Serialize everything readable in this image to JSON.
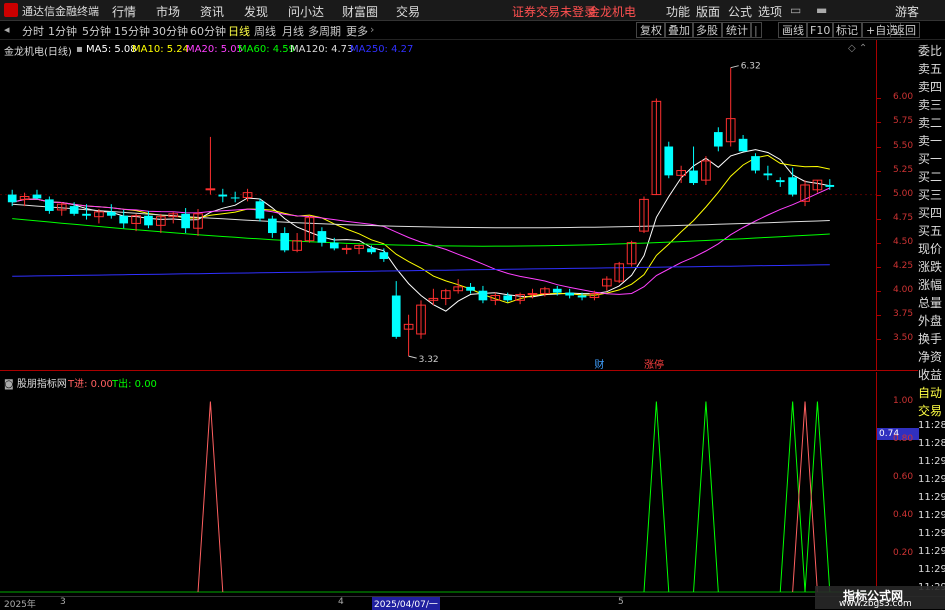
{
  "app": {
    "name": "通达信金融终端",
    "menu": [
      "行情",
      "市场",
      "资讯",
      "发现",
      "问小达",
      "财富圈",
      "交易"
    ],
    "notice": "证券交易未登录",
    "stock_name_top": "金龙机电",
    "title_actions": [
      "功能",
      "版面",
      "公式",
      "选项"
    ],
    "user": "游客"
  },
  "periods": [
    "分时",
    "1分钟",
    "5分钟",
    "15分钟",
    "30分钟",
    "60分钟",
    "日线",
    "周线",
    "月线",
    "多周期",
    "更多"
  ],
  "active_period": "日线",
  "toolbar_right": [
    "复权",
    "叠加",
    "多股",
    "统计",
    "画线",
    "F10",
    "标记",
    "+自选",
    "返回"
  ],
  "main_chart": {
    "title": "金龙机电(日线)",
    "ma": [
      {
        "label": "MA5: 5.08",
        "color": "#ffffff"
      },
      {
        "label": "MA10: 5.24",
        "color": "#ffff00"
      },
      {
        "label": "MA20: 5.05",
        "color": "#ff40ff"
      },
      {
        "label": "MA60: 4.59",
        "color": "#00ff00"
      },
      {
        "label": "MA120: 4.73",
        "color": "#dddddd"
      },
      {
        "label": "MA250: 4.27",
        "color": "#3030ff"
      }
    ],
    "y_ticks": [
      "6.00",
      "5.75",
      "5.50",
      "5.25",
      "5.00",
      "4.75",
      "4.50",
      "4.25",
      "4.00",
      "3.75",
      "3.50"
    ],
    "high_label": "6.32",
    "low_label": "3.32",
    "event_labels": [
      "财",
      "涨停"
    ]
  },
  "sub_chart": {
    "title": "股朋指标网",
    "t_in": "T进: 0.00",
    "t_out": "T出: 0.00",
    "y_ticks": [
      "1.00",
      "0.80",
      "0.60",
      "0.40",
      "0.20"
    ],
    "current_value": "0.74"
  },
  "right_panel": [
    "委比",
    "卖五",
    "卖四",
    "卖三",
    "卖二",
    "卖一",
    "买一",
    "买二",
    "买三",
    "买四",
    "买五",
    "现价",
    "涨跌",
    "涨幅",
    "总量",
    "外盘",
    "换手",
    "净资",
    "收益",
    "自动",
    "交易",
    "11:28",
    "11:28",
    "11:29",
    "11:29",
    "11:29",
    "11:29",
    "11:29",
    "11:29",
    "11:29",
    "11:29"
  ],
  "time_axis": [
    "2025年",
    "3",
    "4",
    "2025/04/07/一",
    "5"
  ],
  "watermark": {
    "line1": "指标公式网",
    "line2": "www.zbgs3.com"
  },
  "chart_data": [
    {
      "type": "candlestick",
      "title": "金龙机电(日线)",
      "ylim": [
        3.3,
        6.4
      ],
      "candles": [
        {
          "o": 5.0,
          "h": 5.05,
          "l": 4.88,
          "c": 4.92
        },
        {
          "o": 4.95,
          "h": 5.02,
          "l": 4.88,
          "c": 4.98
        },
        {
          "o": 5.0,
          "h": 5.05,
          "l": 4.95,
          "c": 4.96
        },
        {
          "o": 4.95,
          "h": 4.98,
          "l": 4.8,
          "c": 4.83
        },
        {
          "o": 4.84,
          "h": 4.92,
          "l": 4.78,
          "c": 4.9
        },
        {
          "o": 4.88,
          "h": 4.92,
          "l": 4.78,
          "c": 4.8
        },
        {
          "o": 4.8,
          "h": 4.9,
          "l": 4.74,
          "c": 4.78
        },
        {
          "o": 4.77,
          "h": 4.85,
          "l": 4.7,
          "c": 4.82
        },
        {
          "o": 4.82,
          "h": 4.9,
          "l": 4.75,
          "c": 4.78
        },
        {
          "o": 4.78,
          "h": 4.84,
          "l": 4.65,
          "c": 4.7
        },
        {
          "o": 4.7,
          "h": 4.8,
          "l": 4.62,
          "c": 4.78
        },
        {
          "o": 4.78,
          "h": 4.83,
          "l": 4.65,
          "c": 4.68
        },
        {
          "o": 4.68,
          "h": 4.8,
          "l": 4.6,
          "c": 4.77
        },
        {
          "o": 4.77,
          "h": 4.82,
          "l": 4.7,
          "c": 4.8
        },
        {
          "o": 4.8,
          "h": 4.86,
          "l": 4.6,
          "c": 4.65
        },
        {
          "o": 4.65,
          "h": 4.85,
          "l": 4.57,
          "c": 4.8
        },
        {
          "o": 5.06,
          "h": 5.6,
          "l": 5.0,
          "c": 5.06
        },
        {
          "o": 5.0,
          "h": 5.06,
          "l": 4.92,
          "c": 4.98
        },
        {
          "o": 4.97,
          "h": 5.03,
          "l": 4.92,
          "c": 4.96
        },
        {
          "o": 4.97,
          "h": 5.06,
          "l": 4.93,
          "c": 5.02
        },
        {
          "o": 4.93,
          "h": 4.96,
          "l": 4.72,
          "c": 4.75
        },
        {
          "o": 4.75,
          "h": 4.78,
          "l": 4.55,
          "c": 4.6
        },
        {
          "o": 4.6,
          "h": 4.66,
          "l": 4.4,
          "c": 4.42
        },
        {
          "o": 4.42,
          "h": 4.6,
          "l": 4.4,
          "c": 4.52
        },
        {
          "o": 4.52,
          "h": 4.78,
          "l": 4.5,
          "c": 4.76
        },
        {
          "o": 4.62,
          "h": 4.66,
          "l": 4.46,
          "c": 4.5
        },
        {
          "o": 4.5,
          "h": 4.55,
          "l": 4.42,
          "c": 4.44
        },
        {
          "o": 4.44,
          "h": 4.48,
          "l": 4.38,
          "c": 4.44
        },
        {
          "o": 4.44,
          "h": 4.48,
          "l": 4.38,
          "c": 4.47
        },
        {
          "o": 4.44,
          "h": 4.47,
          "l": 4.38,
          "c": 4.4
        },
        {
          "o": 4.4,
          "h": 4.44,
          "l": 4.3,
          "c": 4.33
        },
        {
          "o": 3.95,
          "h": 4.1,
          "l": 3.5,
          "c": 3.52
        },
        {
          "o": 3.6,
          "h": 3.75,
          "l": 3.32,
          "c": 3.65
        },
        {
          "o": 3.55,
          "h": 3.9,
          "l": 3.5,
          "c": 3.85
        },
        {
          "o": 3.9,
          "h": 4.02,
          "l": 3.85,
          "c": 3.92
        },
        {
          "o": 3.92,
          "h": 4.02,
          "l": 3.85,
          "c": 4.0
        },
        {
          "o": 4.0,
          "h": 4.12,
          "l": 3.97,
          "c": 4.04
        },
        {
          "o": 4.04,
          "h": 4.08,
          "l": 3.97,
          "c": 4.0
        },
        {
          "o": 4.0,
          "h": 4.05,
          "l": 3.87,
          "c": 3.9
        },
        {
          "o": 3.9,
          "h": 3.98,
          "l": 3.85,
          "c": 3.95
        },
        {
          "o": 3.95,
          "h": 3.98,
          "l": 3.88,
          "c": 3.9
        },
        {
          "o": 3.9,
          "h": 3.98,
          "l": 3.86,
          "c": 3.96
        },
        {
          "o": 3.96,
          "h": 4.02,
          "l": 3.92,
          "c": 3.97
        },
        {
          "o": 3.97,
          "h": 4.04,
          "l": 3.94,
          "c": 4.02
        },
        {
          "o": 4.02,
          "h": 4.05,
          "l": 3.95,
          "c": 3.98
        },
        {
          "o": 3.98,
          "h": 4.02,
          "l": 3.92,
          "c": 3.95
        },
        {
          "o": 3.95,
          "h": 3.98,
          "l": 3.9,
          "c": 3.93
        },
        {
          "o": 3.93,
          "h": 4.0,
          "l": 3.9,
          "c": 3.97
        },
        {
          "o": 4.05,
          "h": 4.15,
          "l": 4.0,
          "c": 4.12
        },
        {
          "o": 4.1,
          "h": 4.3,
          "l": 4.08,
          "c": 4.28
        },
        {
          "o": 4.28,
          "h": 4.52,
          "l": 4.25,
          "c": 4.5
        },
        {
          "o": 4.62,
          "h": 4.98,
          "l": 4.6,
          "c": 4.95
        },
        {
          "o": 5.0,
          "h": 6.0,
          "l": 5.0,
          "c": 5.97
        },
        {
          "o": 5.5,
          "h": 5.55,
          "l": 5.17,
          "c": 5.2
        },
        {
          "o": 5.2,
          "h": 5.3,
          "l": 5.12,
          "c": 5.25
        },
        {
          "o": 5.25,
          "h": 5.5,
          "l": 5.1,
          "c": 5.12
        },
        {
          "o": 5.15,
          "h": 5.4,
          "l": 5.1,
          "c": 5.35
        },
        {
          "o": 5.65,
          "h": 5.7,
          "l": 5.45,
          "c": 5.5
        },
        {
          "o": 5.55,
          "h": 6.32,
          "l": 5.5,
          "c": 5.79
        },
        {
          "o": 5.58,
          "h": 5.62,
          "l": 5.45,
          "c": 5.45
        },
        {
          "o": 5.4,
          "h": 5.43,
          "l": 5.22,
          "c": 5.25
        },
        {
          "o": 5.22,
          "h": 5.3,
          "l": 5.15,
          "c": 5.2
        },
        {
          "o": 5.15,
          "h": 5.18,
          "l": 5.08,
          "c": 5.13
        },
        {
          "o": 5.18,
          "h": 5.28,
          "l": 4.98,
          "c": 5.0
        },
        {
          "o": 4.93,
          "h": 5.15,
          "l": 4.88,
          "c": 5.1
        },
        {
          "o": 5.05,
          "h": 5.15,
          "l": 5.02,
          "c": 5.15
        },
        {
          "o": 5.1,
          "h": 5.16,
          "l": 5.05,
          "c": 5.08
        }
      ]
    },
    {
      "type": "line",
      "title": "股朋指标网",
      "ylim": [
        0,
        1.05
      ],
      "series": [
        {
          "name": "T进",
          "color": "#00ff00",
          "peaks": [
            52,
            56,
            63,
            65
          ]
        },
        {
          "name": "T出",
          "color": "#ff6060",
          "peaks": [
            16,
            64
          ]
        }
      ],
      "n": 67
    }
  ]
}
